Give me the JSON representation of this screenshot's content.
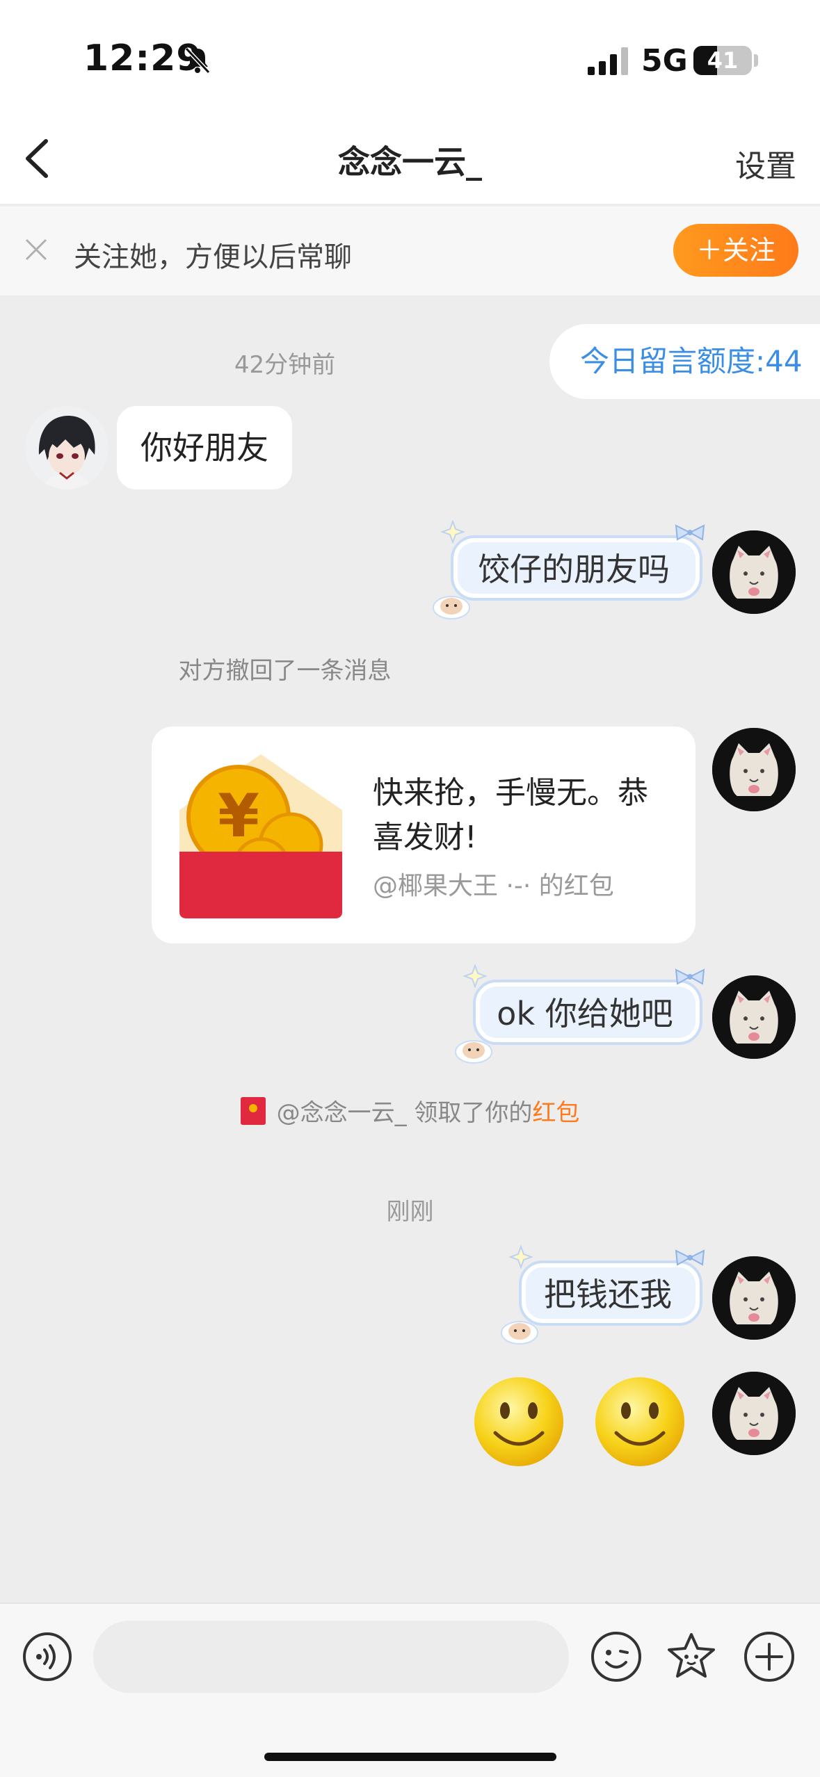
{
  "status": {
    "time": "12:29",
    "network": "5G",
    "battery": "41",
    "battery_level": 0.41
  },
  "nav": {
    "title": "念念一云_",
    "settings": "设置"
  },
  "follow": {
    "text": "关注她，方便以后常聊",
    "button": "＋关注"
  },
  "chat": {
    "quota": "今日留言额度:44",
    "time1": "42分钟前",
    "msg_hello": "你好朋友",
    "msg_friend": "饺仔的朋友吗",
    "recalled": "对方撤回了一条消息",
    "redpacket": {
      "title": "快来抢，手慢无。恭喜发财!",
      "from": "@椰果大王 ·-· 的红包",
      "symbol": "¥"
    },
    "msg_ok": "ok 你给她吧",
    "received": {
      "prefix": "@念念一云_ 领取了你的",
      "highlight": "红包"
    },
    "time2": "刚刚",
    "msg_money": "把钱还我"
  },
  "input": {
    "placeholder": ""
  },
  "colors": {
    "accent": "#ff7a1a",
    "quota": "#3a8ee6",
    "redpacket": "#e0283f"
  }
}
